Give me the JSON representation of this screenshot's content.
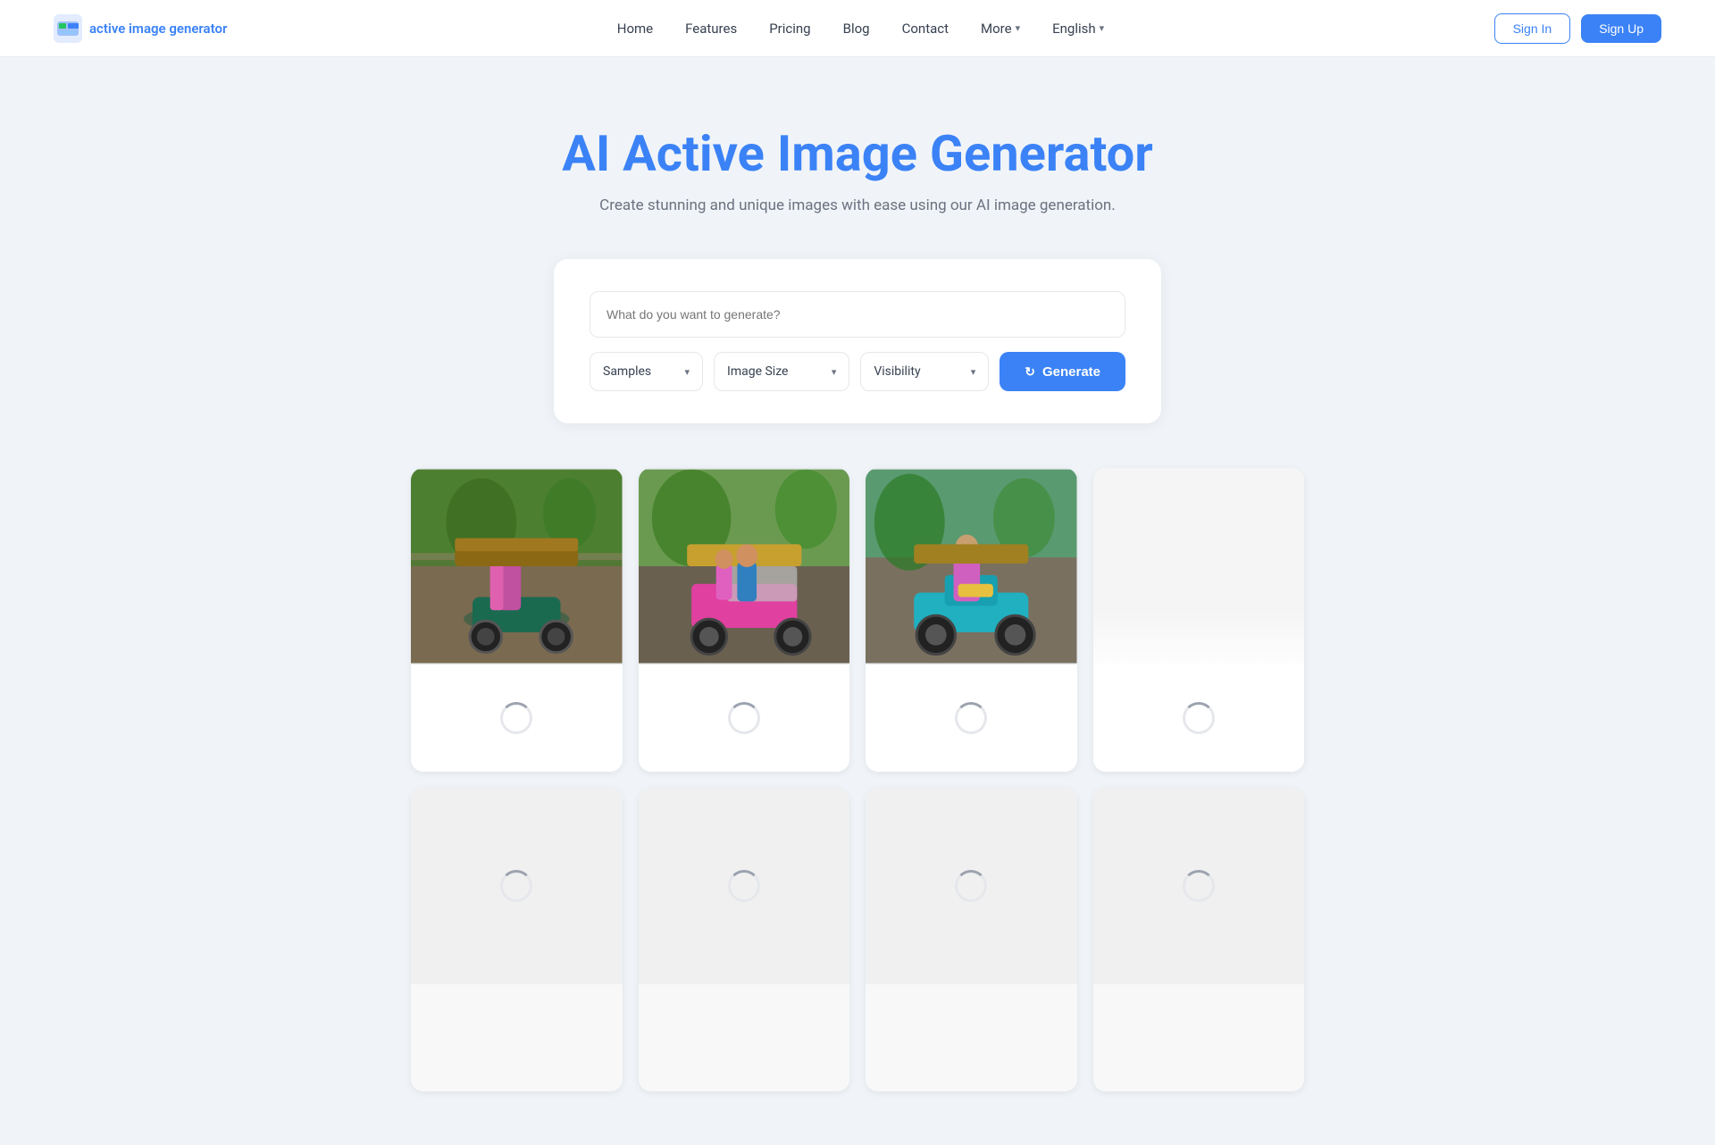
{
  "navbar": {
    "logo_text": "active image generator",
    "nav_links": [
      {
        "label": "Home",
        "id": "home"
      },
      {
        "label": "Features",
        "id": "features"
      },
      {
        "label": "Pricing",
        "id": "pricing"
      },
      {
        "label": "Blog",
        "id": "blog"
      },
      {
        "label": "Contact",
        "id": "contact"
      }
    ],
    "dropdowns": [
      {
        "label": "More",
        "id": "more"
      },
      {
        "label": "English",
        "id": "english"
      }
    ],
    "signin_label": "Sign In",
    "signup_label": "Sign Up"
  },
  "hero": {
    "title": "AI Active Image Generator",
    "subtitle": "Create stunning and unique images with ease using our AI image generation."
  },
  "generator": {
    "prompt_placeholder": "What do you want to generate?",
    "samples_label": "Samples",
    "image_size_label": "Image Size",
    "visibility_label": "Visibility",
    "generate_label": "Generate"
  },
  "images": {
    "top_row": [
      {
        "id": "img1",
        "has_photo": true,
        "color1": "#4a7c3f",
        "color2": "#e94b9a"
      },
      {
        "id": "img2",
        "has_photo": true,
        "color1": "#3a8a50",
        "color2": "#d63a75"
      },
      {
        "id": "img3",
        "has_photo": true,
        "color1": "#4a9960",
        "color2": "#c87d3a"
      },
      {
        "id": "img4",
        "has_photo": false
      }
    ],
    "bottom_row": [
      {
        "id": "img5",
        "has_photo": false
      },
      {
        "id": "img6",
        "has_photo": false
      },
      {
        "id": "img7",
        "has_photo": false
      },
      {
        "id": "img8",
        "has_photo": false
      }
    ]
  }
}
